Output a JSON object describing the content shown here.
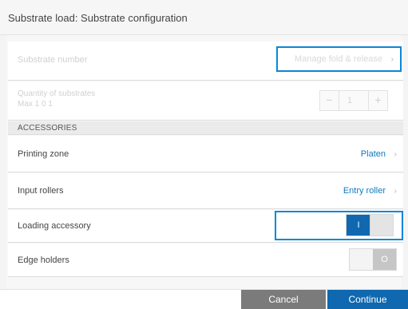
{
  "dialog": {
    "title": "Substrate load: Substrate configuration"
  },
  "rows": {
    "substrate_number": {
      "label": "Substrate number",
      "value": "Manage fold & release",
      "chevron": "›",
      "state": "disabled"
    },
    "quantity": {
      "label_line1": "Quantity of substrates",
      "label_line2": "Max 1 0  1",
      "value": "1",
      "minus": "−",
      "plus": "+",
      "state": "disabled"
    },
    "section_header": "ACCESSORIES",
    "printing_zone": {
      "label": "Printing zone",
      "value": "Platen",
      "chevron": "›"
    },
    "input_rollers": {
      "label": "Input rollers",
      "value": "Entry roller",
      "chevron": "›"
    },
    "loading_accessory": {
      "label": "Loading accessory",
      "toggle_on_text": "I",
      "state": "on"
    },
    "edge_holders": {
      "label": "Edge holders",
      "toggle_off_text": "O",
      "state": "off"
    }
  },
  "footer": {
    "cancel_label": "Cancel",
    "continue_label": "Continue"
  },
  "colors": {
    "accent_blue": "#0a86d6",
    "primary_button": "#0f68b0",
    "secondary_button": "#7b7b7b",
    "link_text": "#0f7ac0"
  },
  "icons": {
    "chevron": "chevron-right-icon",
    "minus": "minus-icon",
    "plus": "plus-icon"
  }
}
